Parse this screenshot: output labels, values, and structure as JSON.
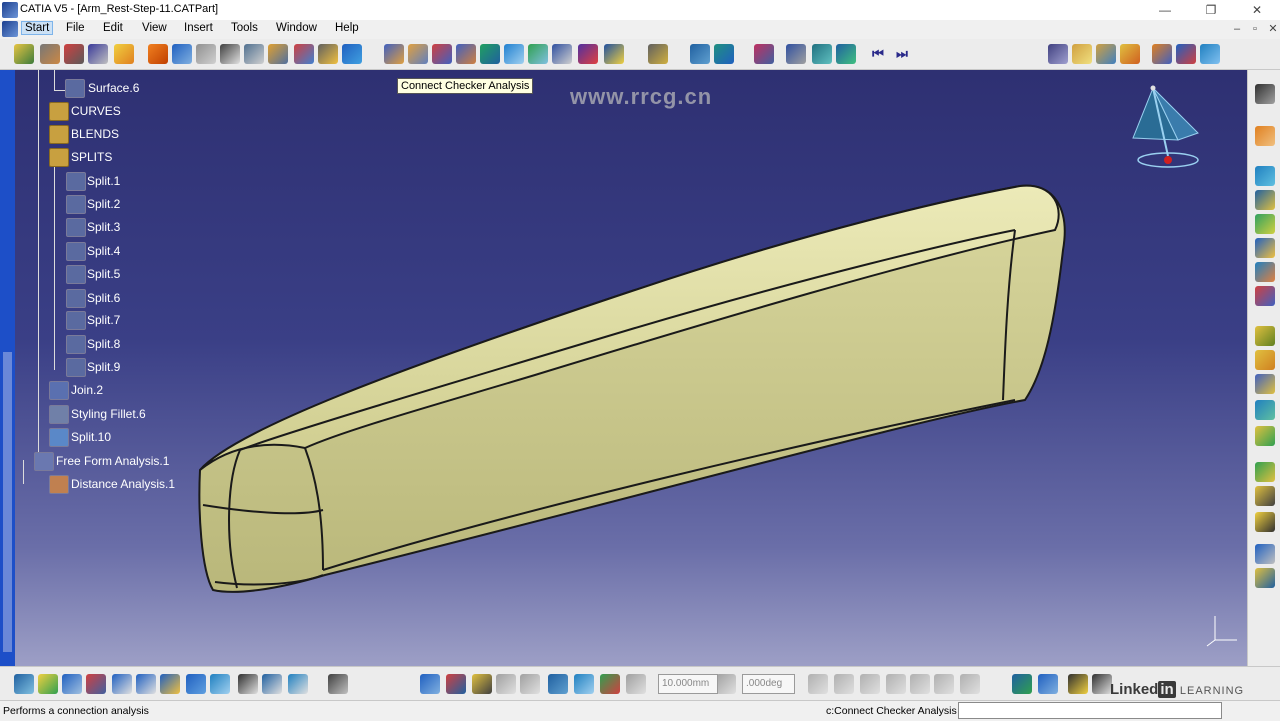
{
  "window": {
    "title": "CATIA V5 - [Arm_Rest-Step-11.CATPart]",
    "controls": {
      "minimize": "—",
      "maximize": "❐",
      "close": "✕"
    },
    "inner_controls": {
      "minimize": "–",
      "restore": "▫",
      "close": "✕"
    }
  },
  "menubar": {
    "items": [
      "Start",
      "File",
      "Edit",
      "View",
      "Insert",
      "Tools",
      "Window",
      "Help"
    ]
  },
  "tooltip": "Connect Checker Analysis",
  "tree": {
    "items": [
      {
        "label": "Surface.6",
        "icon": "surface-icon"
      },
      {
        "label": "CURVES",
        "icon": "geometrical-set-icon"
      },
      {
        "label": "BLENDS",
        "icon": "geometrical-set-icon"
      },
      {
        "label": "SPLITS",
        "icon": "geometrical-set-icon"
      },
      {
        "label": "Split.1",
        "icon": "split-icon"
      },
      {
        "label": "Split.2",
        "icon": "split-icon"
      },
      {
        "label": "Split.3",
        "icon": "split-icon"
      },
      {
        "label": "Split.4",
        "icon": "split-icon"
      },
      {
        "label": "Split.5",
        "icon": "split-icon"
      },
      {
        "label": "Split.6",
        "icon": "split-icon"
      },
      {
        "label": "Split.7",
        "icon": "split-icon"
      },
      {
        "label": "Split.8",
        "icon": "split-icon"
      },
      {
        "label": "Split.9",
        "icon": "split-icon"
      },
      {
        "label": "Join.2",
        "icon": "join-icon"
      },
      {
        "label": "Styling Fillet.6",
        "icon": "styling-fillet-icon"
      },
      {
        "label": "Split.10",
        "icon": "split-icon"
      },
      {
        "label": "Free Form Analysis.1",
        "icon": "analysis-icon"
      },
      {
        "label": "Distance Analysis.1",
        "icon": "distance-analysis-icon"
      }
    ]
  },
  "bottom_toolbar": {
    "step_value": "10.000mm",
    "angle_value": ".000deg"
  },
  "status": {
    "message": "Performs a connection analysis",
    "command": "c:Connect Checker Analysis",
    "command_input": ""
  },
  "overlay": {
    "watermark": "www.rrcg.cn",
    "brand_linked": "Linked",
    "brand_in": "in",
    "brand_learning": "LEARNING"
  },
  "colors": {
    "viewport_top": "#2e3072",
    "viewport_bottom": "#9d9fc6",
    "part_surface": "#d4d39a",
    "tree_text": "#ffffff",
    "tooltip_bg": "#ffffe1"
  }
}
